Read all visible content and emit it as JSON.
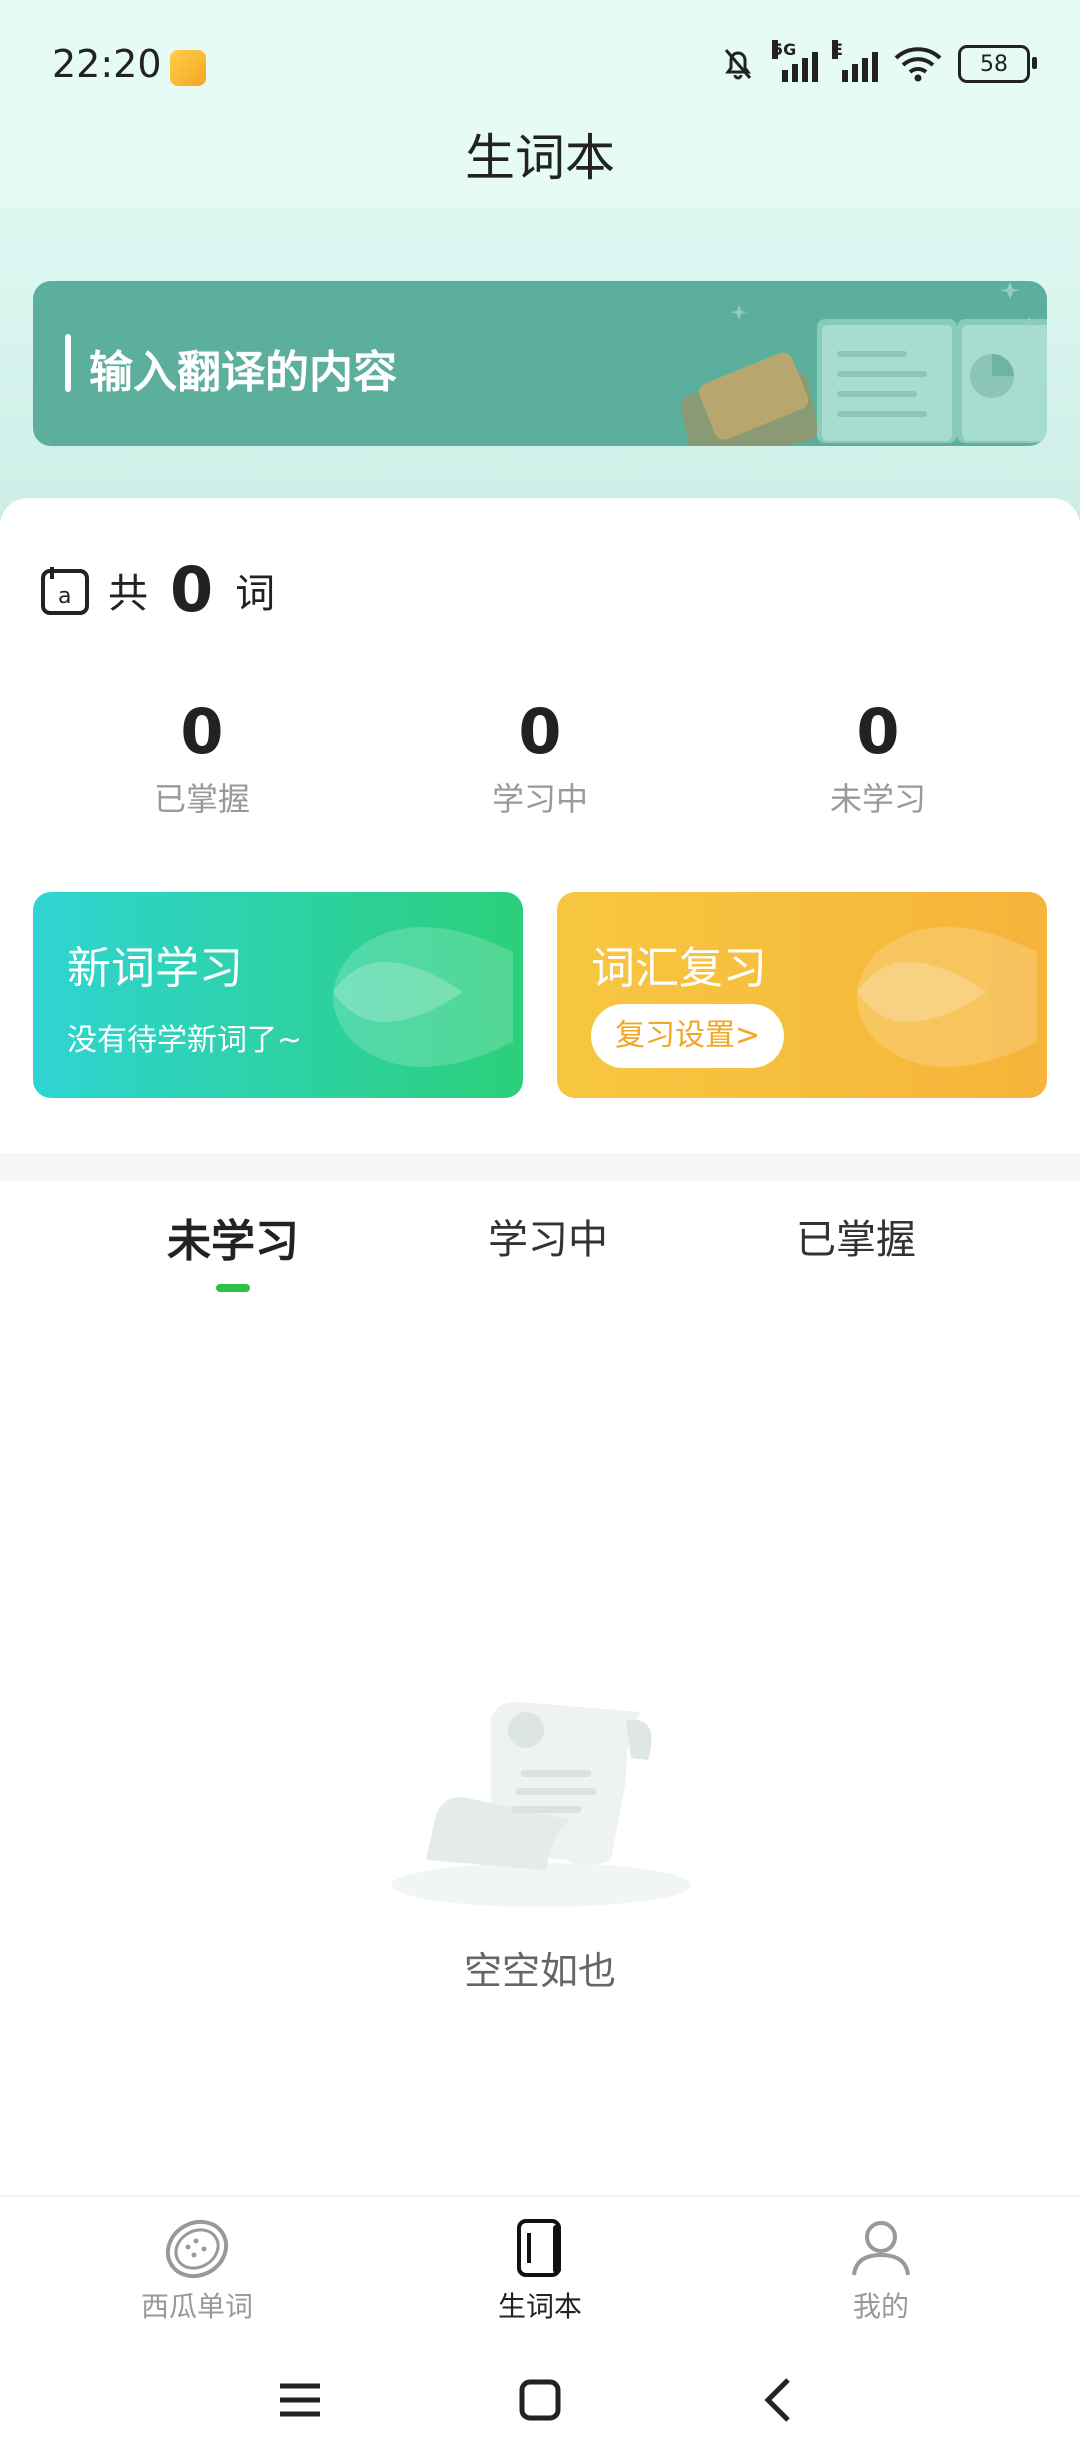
{
  "status_bar": {
    "time": "22:20",
    "network_tag_1": "5G",
    "network_tag_2": "E",
    "battery": "58"
  },
  "header": {
    "title": "生词本"
  },
  "banner": {
    "placeholder": "输入翻译的内容"
  },
  "summary": {
    "prefix": "共",
    "count": "0",
    "suffix": "词"
  },
  "stats": [
    {
      "value": "0",
      "label": "已掌握"
    },
    {
      "value": "0",
      "label": "学习中"
    },
    {
      "value": "0",
      "label": "未学习"
    }
  ],
  "cards": {
    "new": {
      "title": "新词学习",
      "subtitle": "没有待学新词了~"
    },
    "review": {
      "title": "词汇复习",
      "button": "复习设置>"
    }
  },
  "tabs": [
    {
      "label": "未学习",
      "active": true
    },
    {
      "label": "学习中",
      "active": false
    },
    {
      "label": "已掌握",
      "active": false
    }
  ],
  "empty": {
    "text": "空空如也"
  },
  "bottom_nav": [
    {
      "label": "西瓜单词",
      "icon": "watermelon-icon",
      "active": false
    },
    {
      "label": "生词本",
      "icon": "notebook-icon",
      "active": true
    },
    {
      "label": "我的",
      "icon": "person-icon",
      "active": false
    }
  ],
  "colors": {
    "accent_green": "#2cc24a",
    "banner": "#5cae9d",
    "card_green": "#2ccf79",
    "card_orange": "#f6b43a"
  }
}
